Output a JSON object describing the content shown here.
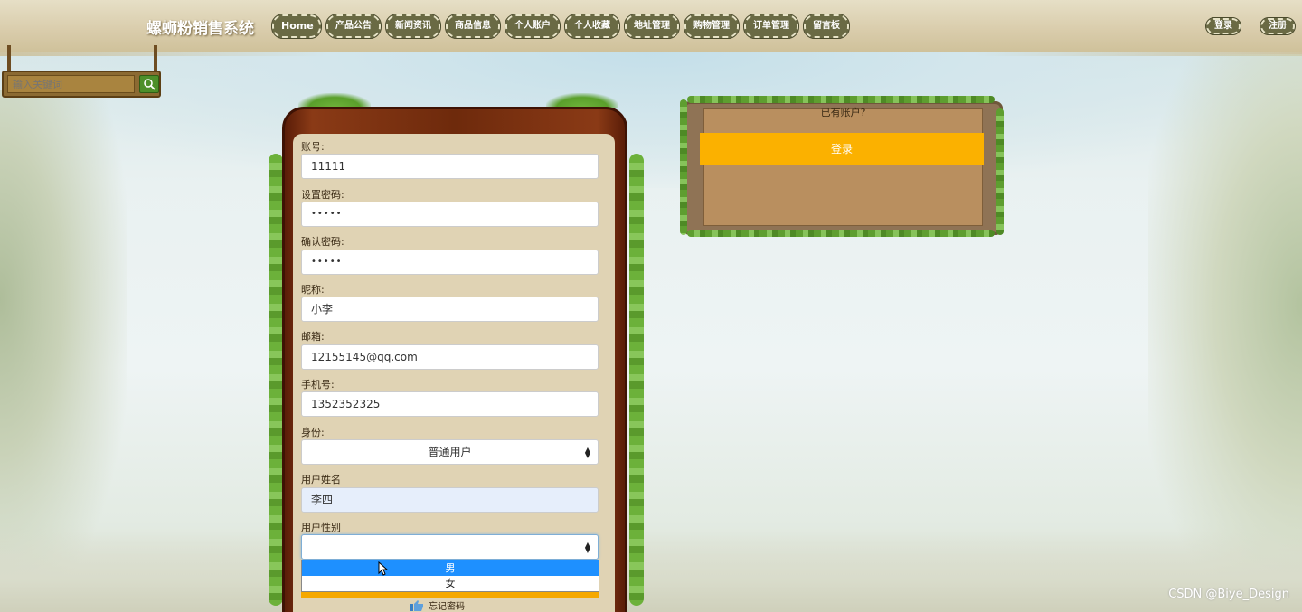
{
  "header": {
    "site_title": "螺蛳粉销售系统",
    "nav": [
      "Home",
      "产品公告",
      "新闻资讯",
      "商品信息",
      "个人账户",
      "个人收藏",
      "地址管理",
      "购物管理",
      "订单管理",
      "留言板"
    ],
    "login_label": "登录",
    "register_label": "注册"
  },
  "search": {
    "placeholder": "输入关键词",
    "icon": "search-icon"
  },
  "form": {
    "account": {
      "label": "账号:",
      "value": "11111"
    },
    "password": {
      "label": "设置密码:",
      "value": "•••••"
    },
    "confirm_password": {
      "label": "确认密码:",
      "value": "•••••"
    },
    "nickname": {
      "label": "昵称:",
      "value": "小李"
    },
    "email": {
      "label": "邮箱:",
      "value": "12155145@qq.com"
    },
    "phone": {
      "label": "手机号:",
      "value": "1352352325"
    },
    "role": {
      "label": "身份:",
      "value": "普通用户"
    },
    "real_name": {
      "label": "用户姓名",
      "value": "李四"
    },
    "gender": {
      "label": "用户性别",
      "value": "",
      "options": [
        "男",
        "女"
      ],
      "highlighted": "男"
    },
    "forgot_label": "忘记密码"
  },
  "login_panel": {
    "prompt": "已有账户?",
    "button": "登录"
  },
  "watermark": "CSDN @Biye_Design",
  "colors": {
    "accent": "#fbb100",
    "option_highlight": "#1e90ff",
    "frame": "#6e2a0c"
  }
}
